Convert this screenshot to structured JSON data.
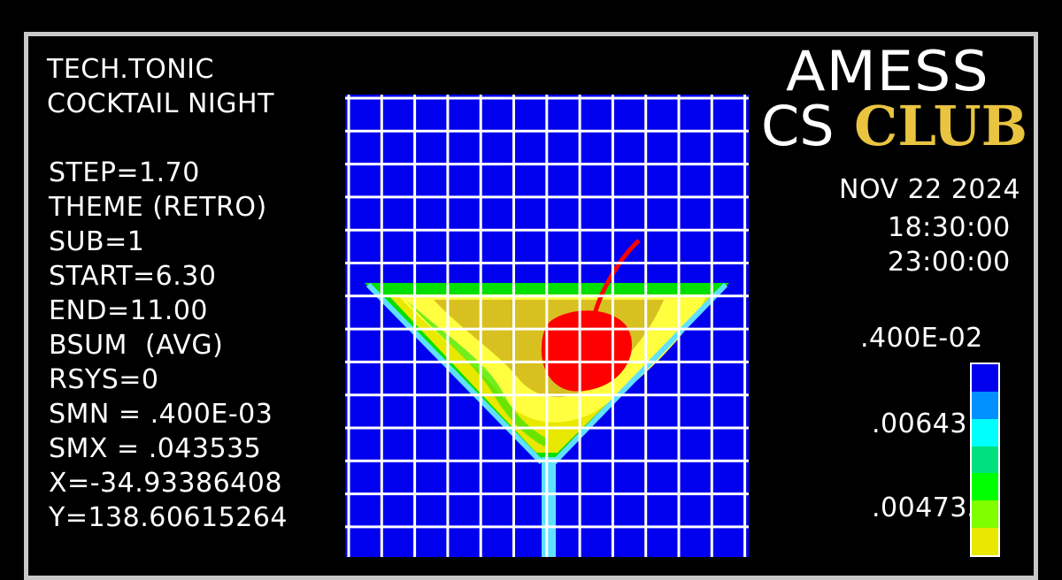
{
  "title_block": {
    "line1": "TECH.TONIC",
    "line2": "COCKTAIL NIGHT"
  },
  "params": [
    "STEP=1.70",
    "THEME (RETRO)",
    "SUB=1",
    "START=6.30",
    "END=11.00",
    "BSUM  (AVG)",
    "RSYS=0",
    "SMN = .400E-03",
    "SMX = .043535",
    "X=-34.93386408",
    "Y=138.60615264"
  ],
  "brand": {
    "line1": "AMESS",
    "cs": "CS",
    "club": "CLUB",
    "club_color": "#e8c440"
  },
  "event": {
    "date": "NOV 22 2024",
    "start_time": "18:30:00",
    "end_time": "23:00:00"
  },
  "legend": {
    "labels": [
      ".400E-02",
      ".006431",
      ".004735"
    ],
    "colors": [
      "#0000ee",
      "#0090ff",
      "#00ffff",
      "#00e080",
      "#00ff00",
      "#80ff00",
      "#e8e800"
    ]
  },
  "colors": {
    "background": "#000000",
    "frame": "#c8c8c8",
    "plot_bg": "#0000ee",
    "grid": "#ffffff",
    "cherry": "#ff0000",
    "contour_outer": "#00e000",
    "contour_mid": "#ffff40",
    "contour_inner": "#d8c020",
    "stem": "#60e0ff"
  }
}
